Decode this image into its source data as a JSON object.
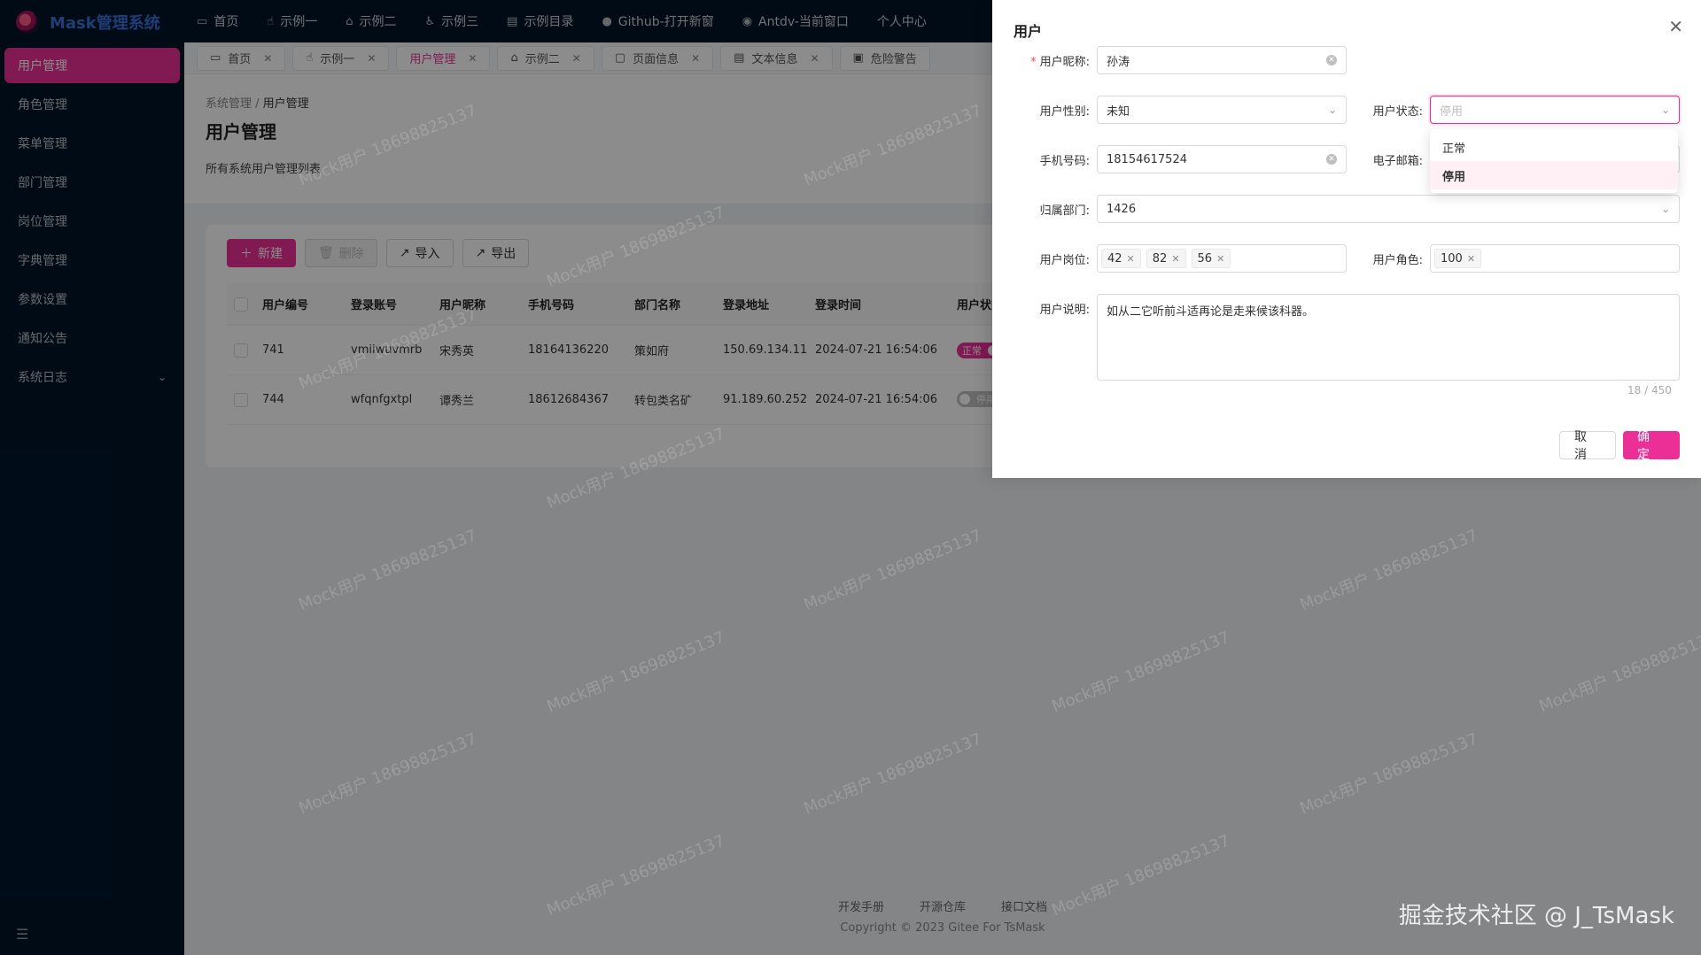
{
  "app": {
    "name": "Mask管理系统"
  },
  "sidebar": {
    "items": [
      {
        "label": "用户管理"
      },
      {
        "label": "角色管理"
      },
      {
        "label": "菜单管理"
      },
      {
        "label": "部门管理"
      },
      {
        "label": "岗位管理"
      },
      {
        "label": "字典管理"
      },
      {
        "label": "参数设置"
      },
      {
        "label": "通知公告"
      },
      {
        "label": "系统日志"
      }
    ],
    "collapse_icon": "menu-fold-icon"
  },
  "topnav": {
    "items": [
      {
        "label": "首页",
        "icon": "desktop-icon"
      },
      {
        "label": "示例一",
        "icon": "hand-icon"
      },
      {
        "label": "示例二",
        "icon": "lock-icon"
      },
      {
        "label": "示例三",
        "icon": "accessibility-icon"
      },
      {
        "label": "示例目录",
        "icon": "file-icon"
      },
      {
        "label": "Github-打开新窗",
        "icon": "github-icon"
      },
      {
        "label": "Antdv-当前窗口",
        "icon": "antdv-icon"
      },
      {
        "label": "个人中心",
        "icon": ""
      }
    ]
  },
  "tabs": {
    "items": [
      {
        "label": "首页"
      },
      {
        "label": "示例一"
      },
      {
        "label": "用户管理"
      },
      {
        "label": "示例二"
      },
      {
        "label": "页面信息"
      },
      {
        "label": "文本信息"
      },
      {
        "label": "危险警告"
      }
    ]
  },
  "page": {
    "breadcrumb": [
      "系统管理",
      "用户管理"
    ],
    "title": "用户管理",
    "description": "所有系统用户管理列表"
  },
  "toolbar": {
    "new_label": "新建",
    "delete_label": "删除",
    "import_label": "导入",
    "export_label": "导出"
  },
  "table": {
    "headers": [
      "用户编号",
      "登录账号",
      "用户昵称",
      "手机号码",
      "部门名称",
      "登录地址",
      "登录时间",
      "用户状态"
    ],
    "rows": [
      {
        "id": "741",
        "account": "vmiiwuvmrb",
        "nickname": "宋秀英",
        "phone": "18164136220",
        "dept": "策如府",
        "ip": "150.69.134.11",
        "time": "2024-07-21 16:54:06",
        "status": "正常"
      },
      {
        "id": "744",
        "account": "wfqnfgxtpl",
        "nickname": "谭秀兰",
        "phone": "18612684367",
        "dept": "转包类名矿",
        "ip": "91.189.60.252",
        "time": "2024-07-21 16:54:06",
        "status": "停用"
      }
    ]
  },
  "footer": {
    "links": [
      "开发手册",
      "开源仓库",
      "接口文档"
    ],
    "copyright": "Copyright © 2023 Gitee For TsMask"
  },
  "watermark": "Mock用户 18698825137",
  "corner_brand": "掘金技术社区 @ J_TsMask",
  "drawer": {
    "title": "用户",
    "fields": {
      "nickname": {
        "label": "用户昵称:",
        "value": "孙涛"
      },
      "gender": {
        "label": "用户性别:",
        "value": "未知"
      },
      "status": {
        "label": "用户状态:",
        "placeholder": "停用"
      },
      "phone": {
        "label": "手机号码:",
        "value": "18154617524"
      },
      "email": {
        "label": "电子邮箱:"
      },
      "dept": {
        "label": "归属部门:",
        "value": "1426"
      },
      "posts": {
        "label": "用户岗位:",
        "tags": [
          "42",
          "82",
          "56"
        ]
      },
      "roles": {
        "label": "用户角色:",
        "tags": [
          "100"
        ]
      },
      "remark": {
        "label": "用户说明:",
        "value": "如从二它听前斗适再论是走来候该科器。",
        "counter": "18 / 450"
      }
    },
    "status_options": [
      "正常",
      "停用"
    ],
    "cancel_label": "取 消",
    "ok_label": "确 定"
  },
  "colors": {
    "primary": "#eb2f96",
    "sidebar_bg": "#001529"
  }
}
